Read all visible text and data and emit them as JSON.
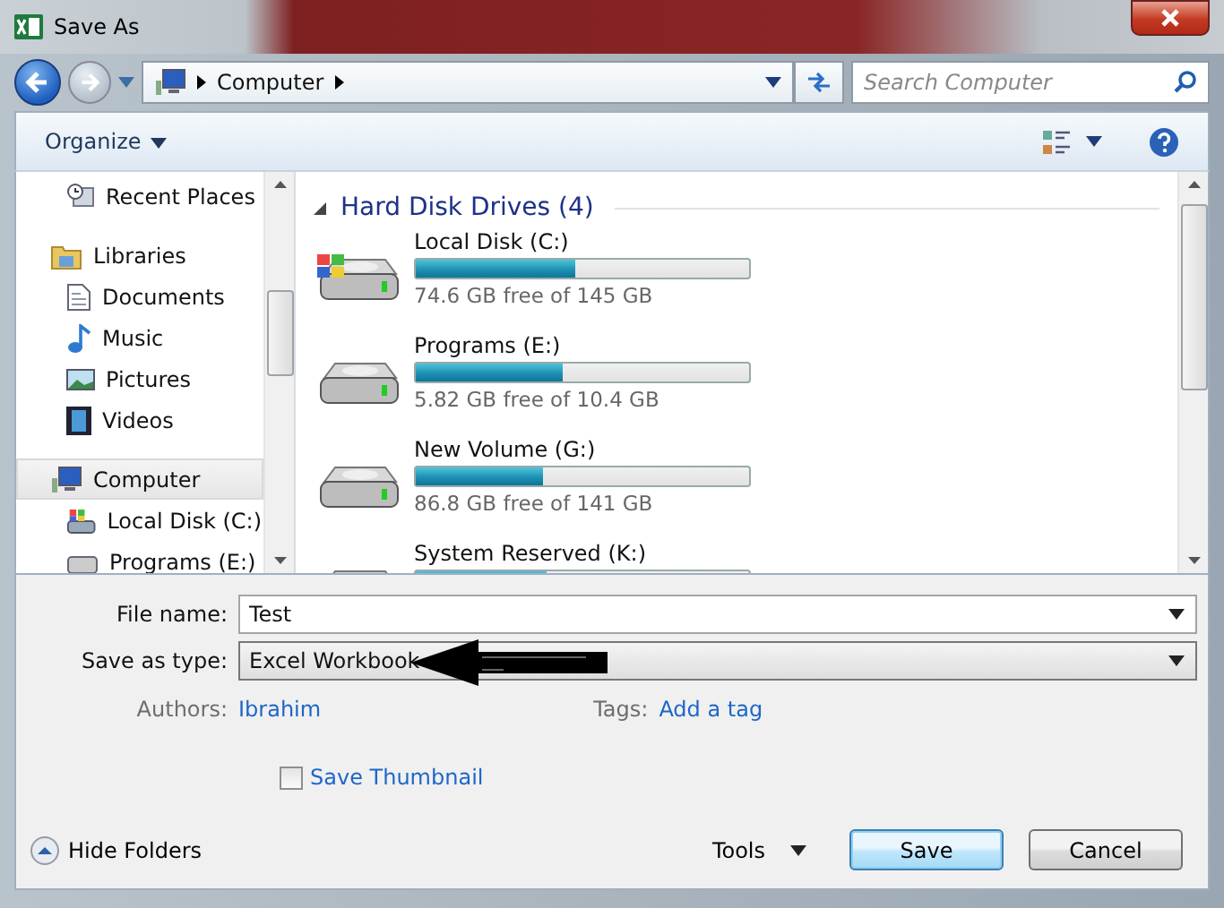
{
  "window": {
    "title": "Save As"
  },
  "address": {
    "crumbs": [
      "Computer"
    ]
  },
  "search": {
    "placeholder": "Search Computer"
  },
  "toolbar": {
    "organize": "Organize"
  },
  "sidebar": {
    "items": [
      {
        "label": "Recent Places",
        "kind": "recent",
        "selected": false
      },
      {
        "label": "Libraries",
        "kind": "library",
        "selected": false,
        "children": [
          {
            "label": "Documents",
            "kind": "documents",
            "selected": false
          },
          {
            "label": "Music",
            "kind": "music",
            "selected": false
          },
          {
            "label": "Pictures",
            "kind": "pictures",
            "selected": false
          },
          {
            "label": "Videos",
            "kind": "videos",
            "selected": false
          }
        ]
      },
      {
        "label": "Computer",
        "kind": "computer",
        "selected": true,
        "children": [
          {
            "label": "Local Disk (C:)",
            "kind": "system-disk",
            "selected": false
          },
          {
            "label": "Programs (E:)",
            "kind": "disk",
            "selected": false
          }
        ]
      }
    ]
  },
  "group": {
    "title": "Hard Disk Drives (4)",
    "expanded": true
  },
  "drives": [
    {
      "name": "Local Disk (C:)",
      "system": true,
      "level": 0.48,
      "free": "74.6 GB free of 145 GB"
    },
    {
      "name": "Programs (E:)",
      "system": false,
      "level": 0.44,
      "free": "5.82 GB free of 10.4 GB"
    },
    {
      "name": "New Volume (G:)",
      "system": false,
      "level": 0.38,
      "free": "86.8 GB free of 141 GB"
    },
    {
      "name": "System Reserved (K:)",
      "system": false,
      "level": 0.39
    }
  ],
  "form": {
    "file_name_label": "File name:",
    "file_name": "Test",
    "type_label": "Save as type:",
    "type": "Excel Workbook",
    "authors_label": "Authors:",
    "authors": "Ibrahim",
    "tags_label": "Tags:",
    "tags_placeholder": "Add a tag",
    "thumbnail": {
      "label": "Save Thumbnail",
      "checked": false
    }
  },
  "footer": {
    "hide_folders": "Hide Folders",
    "tools": "Tools",
    "save": "Save",
    "cancel": "Cancel"
  }
}
